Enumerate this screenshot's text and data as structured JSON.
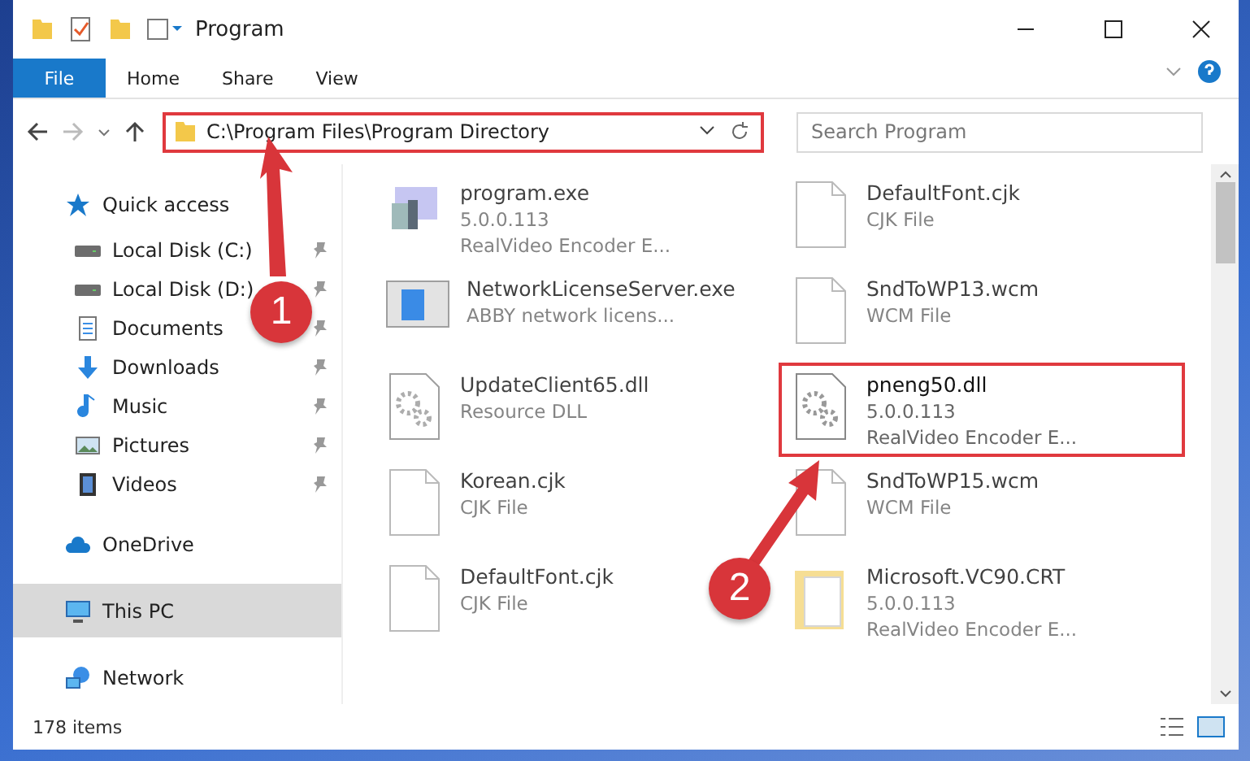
{
  "window": {
    "title": "Program"
  },
  "ribbon_tabs": [
    {
      "label": "File",
      "selected": true
    },
    {
      "label": "Home",
      "selected": false
    },
    {
      "label": "Share",
      "selected": false
    },
    {
      "label": "View",
      "selected": false
    }
  ],
  "address": {
    "path": "C:\\Program Files\\Program Directory",
    "highlighted": true
  },
  "search": {
    "placeholder": "Search Program"
  },
  "sidebar": {
    "items": [
      {
        "label": "Quick access",
        "selected": false,
        "children": [
          {
            "label": "Local Disk (C:)",
            "pinned": true,
            "selected": false
          },
          {
            "label": "Local Disk (D:)",
            "pinned": true,
            "selected": false
          },
          {
            "label": "Documents",
            "pinned": true,
            "selected": false
          },
          {
            "label": "Downloads",
            "pinned": true,
            "selected": false
          },
          {
            "label": "Music",
            "pinned": true,
            "selected": false
          },
          {
            "label": "Pictures",
            "pinned": true,
            "selected": false
          },
          {
            "label": "Videos",
            "pinned": true,
            "selected": false
          }
        ]
      },
      {
        "label": "OneDrive",
        "selected": false
      },
      {
        "label": "This PC",
        "selected": true
      },
      {
        "label": "Network",
        "selected": false
      }
    ]
  },
  "files": [
    {
      "kind": "exe",
      "name": "program.exe",
      "details": [
        "5.0.0.113",
        "RealVideo Encoder E..."
      ],
      "highlighted": false
    },
    {
      "kind": "blank",
      "name": "DefaultFont.cjk",
      "details": [
        "CJK File"
      ],
      "highlighted": false
    },
    {
      "kind": "app",
      "name": "NetworkLicenseServer.exe",
      "details": [
        "ABBY network licens..."
      ],
      "highlighted": false
    },
    {
      "kind": "blank",
      "name": "SndToWP13.wcm",
      "details": [
        "WCM File"
      ],
      "highlighted": false
    },
    {
      "kind": "dll",
      "name": "UpdateClient65.dll",
      "details": [
        "Resource DLL"
      ],
      "highlighted": false
    },
    {
      "kind": "dll",
      "name": "pneng50.dll",
      "details": [
        "5.0.0.113",
        "RealVideo Encoder E..."
      ],
      "highlighted": true
    },
    {
      "kind": "blank",
      "name": "Korean.cjk",
      "details": [
        "CJK File"
      ],
      "highlighted": false
    },
    {
      "kind": "blank",
      "name": "SndToWP15.wcm",
      "details": [
        "WCM File"
      ],
      "highlighted": false
    },
    {
      "kind": "blank",
      "name": "DefaultFont.cjk",
      "details": [
        "CJK File"
      ],
      "highlighted": false
    },
    {
      "kind": "folder",
      "name": "Microsoft.VC90.CRT",
      "details": [
        "5.0.0.113",
        "RealVideo Encoder E..."
      ],
      "highlighted": false
    }
  ],
  "status_bar": {
    "count": "178 items"
  },
  "annotations": [
    {
      "label": "1"
    },
    {
      "label": "2"
    }
  ]
}
